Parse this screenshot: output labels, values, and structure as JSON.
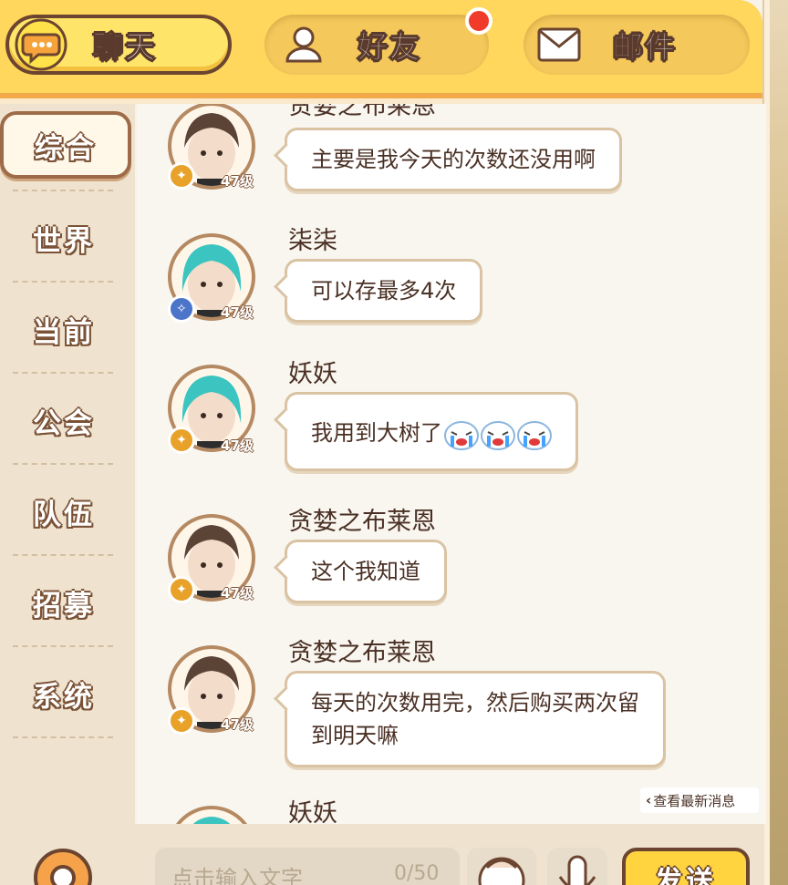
{
  "tabs": {
    "chat": "聊天",
    "friends": "好友",
    "mail": "邮件"
  },
  "sidebar": {
    "items": [
      "综合",
      "世界",
      "当前",
      "公会",
      "队伍",
      "招募",
      "系统"
    ],
    "active_index": 0
  },
  "messages": [
    {
      "name": "贪婪之布莱恩",
      "text": "主要是我今天的次数还没用啊",
      "level": "47级",
      "hair": "brown",
      "badge": "gold"
    },
    {
      "name": "柒柒",
      "text": "可以存最多4次",
      "level": "47级",
      "hair": "teal",
      "badge": "blue"
    },
    {
      "name": "妖妖",
      "text": "我用到大树了",
      "level": "47级",
      "hair": "teal",
      "badge": "gold",
      "emoji": [
        "crying-emoji",
        "crying-emoji",
        "crying-emoji"
      ]
    },
    {
      "name": "贪婪之布莱恩",
      "text": "这个我知道",
      "level": "47级",
      "hair": "brown",
      "badge": "gold"
    },
    {
      "name": "贪婪之布莱恩",
      "text_line1": "每天的次数用完，然后购买两次留",
      "text_line2": "到明天嘛",
      "level": "47级",
      "hair": "brown",
      "badge": "gold"
    },
    {
      "name": "妖妖",
      "hair": "teal"
    }
  ],
  "new_messages_label": "查看最新消息",
  "input": {
    "placeholder": "点击输入文字",
    "count": "0/50"
  },
  "send_label": "发送",
  "colors": {
    "tabbar": "#ffd75c",
    "accent_dot": "#f03a2a",
    "sidebar_bg": "#efe3cf",
    "bubble_border": "#d9c3a3"
  }
}
